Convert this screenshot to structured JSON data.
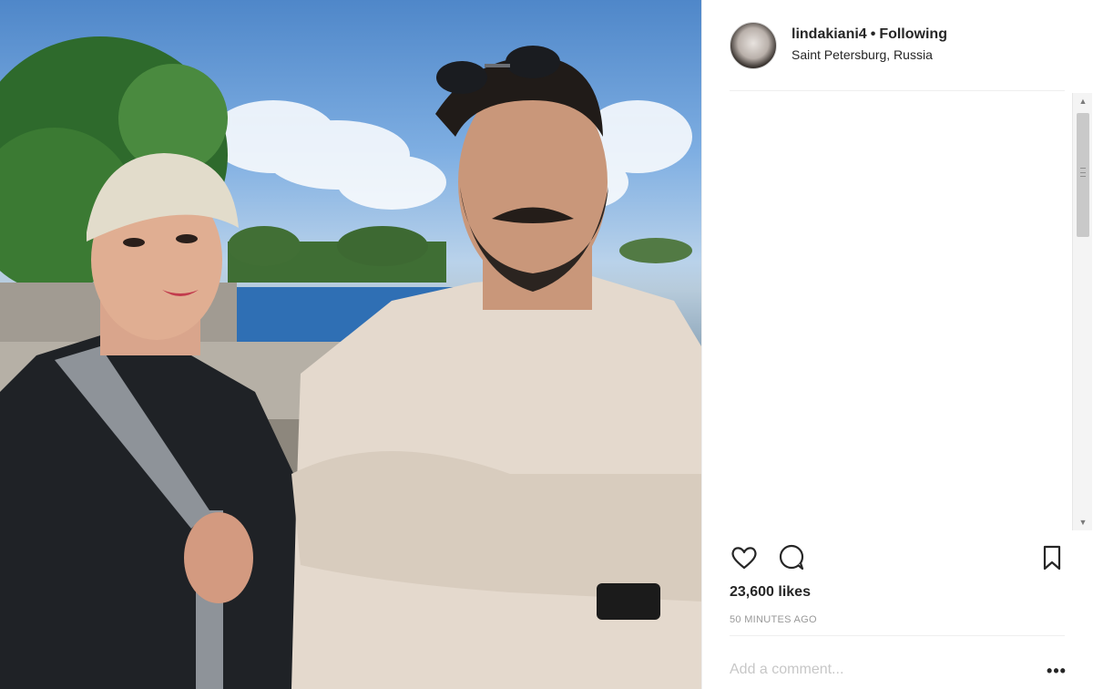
{
  "post": {
    "username": "lindakiani4",
    "separator": "•",
    "follow_status": "Following",
    "location": "Saint Petersburg, Russia",
    "likes": "23,600 likes",
    "timestamp": "50 MINUTES AGO"
  },
  "comment_box": {
    "placeholder": "Add a comment...",
    "more_label": "•••"
  },
  "icons": {
    "like": "heart-icon",
    "comment": "comment-icon",
    "save": "bookmark-icon"
  }
}
